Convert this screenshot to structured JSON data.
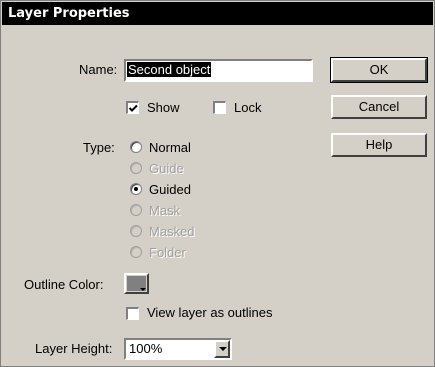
{
  "dialog": {
    "title": "Layer Properties",
    "name_label": "Name:",
    "name_value": "Second object",
    "show_label": "Show",
    "show_checked": true,
    "lock_label": "Lock",
    "lock_checked": false,
    "type_label": "Type:",
    "type_options": [
      {
        "label": "Normal",
        "enabled": true,
        "selected": false
      },
      {
        "label": "Guide",
        "enabled": false,
        "selected": false
      },
      {
        "label": "Guided",
        "enabled": true,
        "selected": true
      },
      {
        "label": "Mask",
        "enabled": false,
        "selected": false
      },
      {
        "label": "Masked",
        "enabled": false,
        "selected": false
      },
      {
        "label": "Folder",
        "enabled": false,
        "selected": false
      }
    ],
    "outline_color_label": "Outline Color:",
    "outline_color": "#808080",
    "view_outlines_label": "View layer as outlines",
    "view_outlines_checked": false,
    "layer_height_label": "Layer Height:",
    "layer_height_value": "100%"
  },
  "buttons": {
    "ok": "OK",
    "cancel": "Cancel",
    "help": "Help"
  }
}
